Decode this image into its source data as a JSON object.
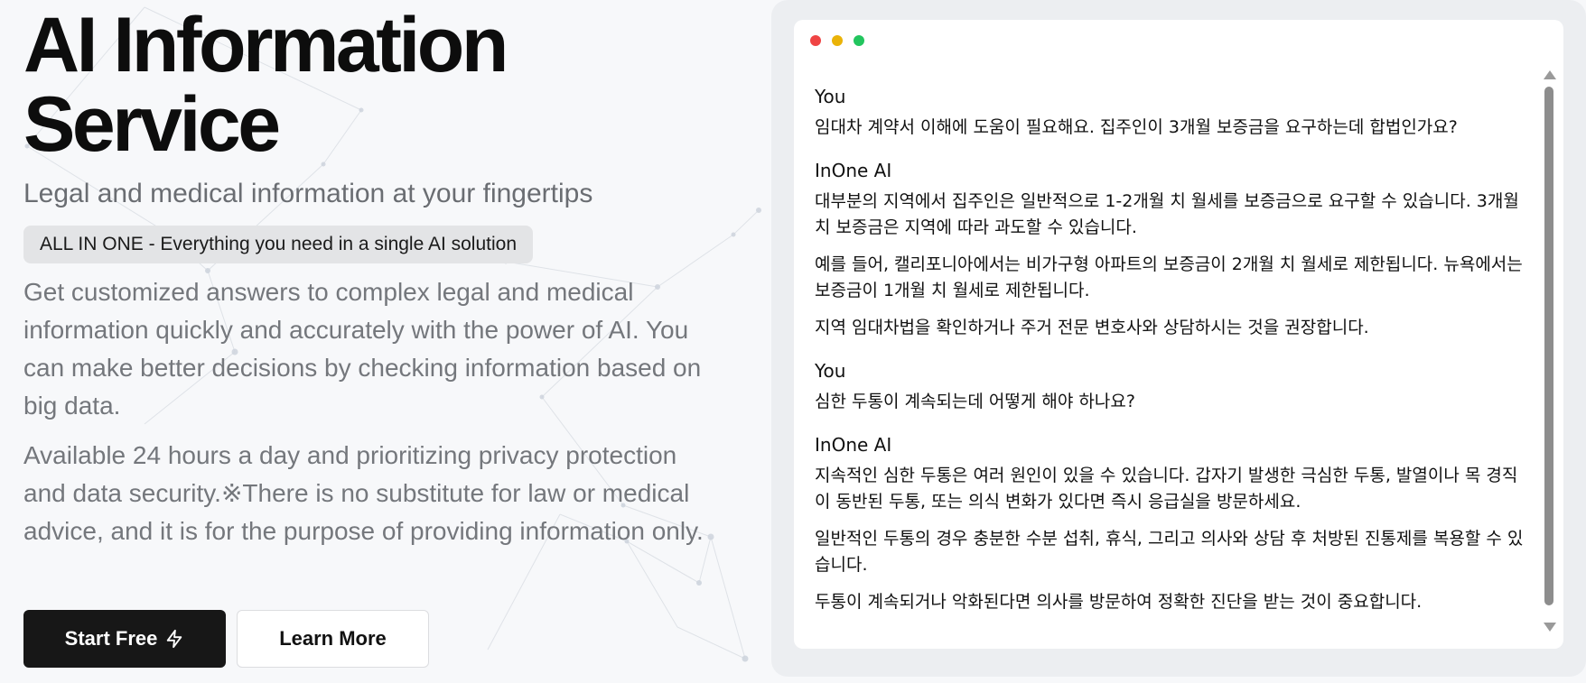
{
  "hero": {
    "title_line1": "AI Information",
    "title_line2": "Service",
    "subtitle": "Legal and medical information at your fingertips",
    "badge": "ALL IN ONE - Everything you need in a single AI solution",
    "desc1": "Get customized answers to complex legal and medical information quickly and accurately with the power of AI. You can make better decisions by checking information based on big data.",
    "desc2": "Available 24 hours a day and prioritizing privacy protection and data security.※There is no substitute for law or medical advice, and it is for the purpose of providing information only.",
    "start_label": "Start Free",
    "start_icon": "lightning-bolt-icon",
    "learn_label": "Learn More"
  },
  "chat": {
    "window_controls": [
      "close",
      "minimize",
      "maximize"
    ],
    "window_colors": {
      "close": "#ef4444",
      "minimize": "#eab308",
      "maximize": "#22c55e"
    },
    "messages": [
      {
        "sender": "You",
        "paragraphs": [
          "임대차 계약서 이해에 도움이 필요해요. 집주인이 3개월 보증금을 요구하는데 합법인가요?"
        ]
      },
      {
        "sender": "InOne AI",
        "paragraphs": [
          "대부분의 지역에서 집주인은 일반적으로 1-2개월 치 월세를 보증금으로 요구할 수 있습니다. 3개월 치 보증금은 지역에 따라 과도할 수 있습니다.",
          "예를 들어, 캘리포니아에서는 비가구형 아파트의 보증금이 2개월 치 월세로 제한됩니다. 뉴욕에서는 보증금이 1개월 치 월세로 제한됩니다.",
          "지역 임대차법을 확인하거나 주거 전문 변호사와 상담하시는 것을 권장합니다."
        ]
      },
      {
        "sender": "You",
        "paragraphs": [
          "심한 두통이 계속되는데 어떻게 해야 하나요?"
        ]
      },
      {
        "sender": "InOne AI",
        "paragraphs": [
          "지속적인 심한 두통은 여러 원인이 있을 수 있습니다. 갑자기 발생한 극심한 두통, 발열이나 목 경직이 동반된 두통, 또는 의식 변화가 있다면 즉시 응급실을 방문하세요.",
          "일반적인 두통의 경우 충분한 수분 섭취, 휴식, 그리고 의사와 상담 후 처방된 진통제를 복용할 수 있습니다.",
          "두통이 계속되거나 악화된다면 의사를 방문하여 정확한 진단을 받는 것이 중요합니다."
        ]
      }
    ]
  }
}
